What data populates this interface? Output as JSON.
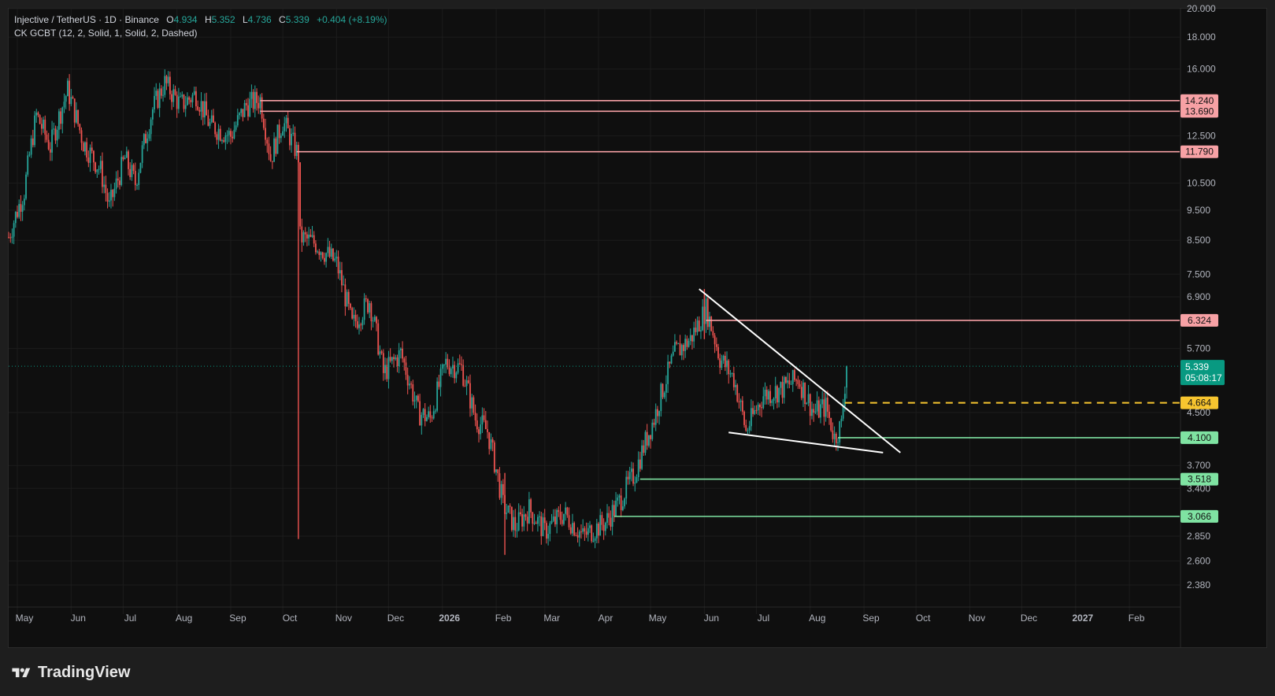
{
  "header": {
    "symbol": "Injective / TetherUS · 1D · Binance",
    "open_label": "O",
    "open": "4.934",
    "high_label": "H",
    "high": "5.352",
    "low_label": "L",
    "low": "4.736",
    "close_label": "C",
    "close": "5.339",
    "change": "+0.404 (+8.19%)",
    "indicator": "CK GCBT (12, 2, Solid, 1, Solid, 2, Dashed)"
  },
  "footer": {
    "brand": "TradingView"
  },
  "colors": {
    "up": "#26a69a",
    "down": "#ef5350",
    "resistance": "#f7a1a5",
    "support": "#7fe3a2",
    "entry": "#f7c52f",
    "trend": "#ffffff",
    "price": "#089981"
  },
  "chart_data": {
    "type": "candlestick",
    "y_scale": "log",
    "ylim": [
      2.2,
      20.0
    ],
    "y_ticks": [
      "2.380",
      "2.600",
      "2.850",
      "3.400",
      "3.700",
      "4.500",
      "5.700",
      "6.900",
      "7.500",
      "8.500",
      "9.500",
      "10.500",
      "12.500",
      "16.000",
      "18.000",
      "20.000"
    ],
    "x_ticks": [
      {
        "label": "May",
        "date": "2025-05-01"
      },
      {
        "label": "Jun",
        "date": "2025-06-01"
      },
      {
        "label": "Jul",
        "date": "2025-07-01"
      },
      {
        "label": "Aug",
        "date": "2025-08-01"
      },
      {
        "label": "Sep",
        "date": "2025-09-01"
      },
      {
        "label": "Oct",
        "date": "2025-10-01"
      },
      {
        "label": "Nov",
        "date": "2025-11-01"
      },
      {
        "label": "Dec",
        "date": "2025-12-01"
      },
      {
        "label": "2026",
        "date": "2026-01-01",
        "bold": true
      },
      {
        "label": "Feb",
        "date": "2026-02-01"
      },
      {
        "label": "Mar",
        "date": "2026-03-01"
      },
      {
        "label": "Apr",
        "date": "2026-04-01"
      },
      {
        "label": "May",
        "date": "2026-05-01"
      },
      {
        "label": "Jun",
        "date": "2026-06-01"
      },
      {
        "label": "Jul",
        "date": "2026-07-01"
      },
      {
        "label": "Aug",
        "date": "2026-08-01"
      },
      {
        "label": "Sep",
        "date": "2026-09-01"
      },
      {
        "label": "Oct",
        "date": "2026-10-01"
      },
      {
        "label": "Nov",
        "date": "2026-11-01"
      },
      {
        "label": "Dec",
        "date": "2026-12-01"
      },
      {
        "label": "2027",
        "date": "2027-01-01",
        "bold": true
      },
      {
        "label": "Feb",
        "date": "2027-02-01"
      }
    ],
    "xlim": [
      "2025-04-26",
      "2027-03-02"
    ],
    "price_path": [
      [
        "2025-04-26",
        8.6
      ],
      [
        "2025-05-05",
        10.2
      ],
      [
        "2025-05-12",
        13.5
      ],
      [
        "2025-05-20",
        12.0
      ],
      [
        "2025-05-30",
        14.8
      ],
      [
        "2025-06-08",
        12.2
      ],
      [
        "2025-06-18",
        11.0
      ],
      [
        "2025-06-23",
        9.6
      ],
      [
        "2025-07-02",
        11.5
      ],
      [
        "2025-07-08",
        10.5
      ],
      [
        "2025-07-18",
        13.8
      ],
      [
        "2025-07-25",
        15.2
      ],
      [
        "2025-08-03",
        14.0
      ],
      [
        "2025-08-12",
        14.6
      ],
      [
        "2025-08-20",
        13.0
      ],
      [
        "2025-09-01",
        12.5
      ],
      [
        "2025-09-10",
        14.0
      ],
      [
        "2025-09-18",
        14.3
      ],
      [
        "2025-09-24",
        11.5
      ],
      [
        "2025-10-01",
        13.2
      ],
      [
        "2025-10-10",
        11.6
      ],
      [
        "2025-10-11",
        8.6
      ],
      [
        "2025-10-20",
        8.4
      ],
      [
        "2025-11-01",
        7.8
      ],
      [
        "2025-11-10",
        6.2
      ],
      [
        "2025-11-20",
        6.8
      ],
      [
        "2025-11-28",
        5.2
      ],
      [
        "2025-12-08",
        5.6
      ],
      [
        "2025-12-18",
        4.5
      ],
      [
        "2025-12-25",
        4.4
      ],
      [
        "2026-01-03",
        5.4
      ],
      [
        "2026-01-12",
        5.3
      ],
      [
        "2026-01-20",
        4.4
      ],
      [
        "2026-01-27",
        4.2
      ],
      [
        "2026-02-05",
        3.2
      ],
      [
        "2026-02-12",
        2.95
      ],
      [
        "2026-02-20",
        3.15
      ],
      [
        "2026-03-01",
        2.9
      ],
      [
        "2026-03-12",
        3.1
      ],
      [
        "2026-03-23",
        2.85
      ],
      [
        "2026-04-05",
        3.0
      ],
      [
        "2026-04-12",
        3.2
      ],
      [
        "2026-04-22",
        3.6
      ],
      [
        "2026-05-03",
        4.4
      ],
      [
        "2026-05-15",
        5.6
      ],
      [
        "2026-05-24",
        5.9
      ],
      [
        "2026-06-02",
        6.6
      ],
      [
        "2026-06-10",
        5.5
      ],
      [
        "2026-06-18",
        5.1
      ],
      [
        "2026-06-25",
        4.2
      ],
      [
        "2026-07-05",
        4.8
      ],
      [
        "2026-07-15",
        4.9
      ],
      [
        "2026-07-25",
        5.1
      ],
      [
        "2026-08-03",
        4.5
      ],
      [
        "2026-08-10",
        4.6
      ],
      [
        "2026-08-15",
        4.1
      ],
      [
        "2026-08-19",
        4.3
      ],
      [
        "2026-08-22",
        5.339
      ]
    ],
    "spikes": [
      {
        "date": "2025-10-10",
        "low": 2.82,
        "high": 11.8
      },
      {
        "date": "2026-02-06",
        "low": 2.66,
        "high": 3.6
      },
      {
        "date": "2026-06-01",
        "low": 5.9,
        "high": 7.1
      }
    ],
    "levels": [
      {
        "value": 14.24,
        "label": "14.240",
        "start": "2025-09-18",
        "kind": "resistance"
      },
      {
        "value": 13.69,
        "label": "13.690",
        "start": "2025-09-18",
        "kind": "resistance"
      },
      {
        "value": 11.79,
        "label": "11.790",
        "start": "2025-10-09",
        "kind": "resistance"
      },
      {
        "value": 6.324,
        "label": "6.324",
        "start": "2026-06-02",
        "kind": "resistance"
      },
      {
        "value": 4.664,
        "label": "4.664",
        "start": "2026-08-21",
        "kind": "entry",
        "dashed": true
      },
      {
        "value": 4.1,
        "label": "4.100",
        "start": "2026-08-17",
        "kind": "support"
      },
      {
        "value": 3.518,
        "label": "3.518",
        "start": "2026-04-25",
        "kind": "support"
      },
      {
        "value": 3.066,
        "label": "3.066",
        "start": "2026-04-10",
        "kind": "support"
      }
    ],
    "trendlines": [
      {
        "from": [
          "2026-05-29",
          7.1
        ],
        "to": [
          "2026-09-22",
          3.88
        ]
      },
      {
        "from": [
          "2026-06-15",
          4.18
        ],
        "to": [
          "2026-09-12",
          3.88
        ]
      }
    ],
    "last_price": {
      "value": 5.339,
      "label": "5.339",
      "countdown": "05:08:17"
    }
  }
}
